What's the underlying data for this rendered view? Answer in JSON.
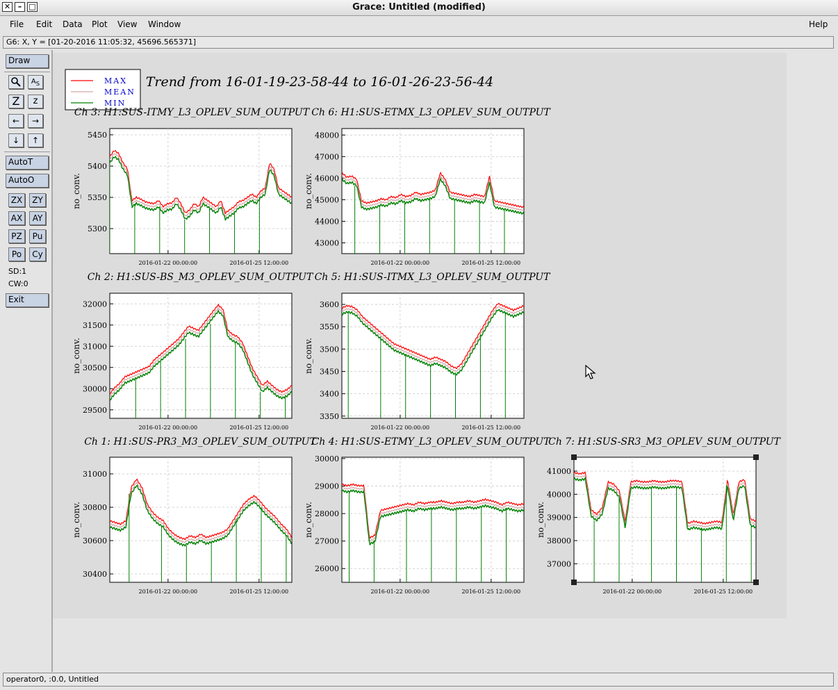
{
  "window": {
    "title": "Grace: Untitled (modified)"
  },
  "menu": {
    "file": "File",
    "edit": "Edit",
    "data": "Data",
    "plot": "Plot",
    "view": "View",
    "window": "Window",
    "help": "Help"
  },
  "locator": "G6: X, Y = [01-20-2016 11:05:32, 45696.565371]",
  "toolbar": {
    "draw": "Draw",
    "autot": "AutoT",
    "autoo": "AutoO",
    "zx": "ZX",
    "zy": "ZY",
    "ax": "AX",
    "ay": "AY",
    "pz": "PZ",
    "pu": "Pu",
    "po": "Po",
    "cy": "Cy",
    "sd": "SD:1",
    "cw": "CW:0",
    "exit": "Exit"
  },
  "status": "operator0, :0.0, Untitled",
  "legend": [
    {
      "label": "MAX",
      "color": "#ff0000"
    },
    {
      "label": "MEAN",
      "color": "#d4a8a8"
    },
    {
      "label": "MIN",
      "color": "#008000"
    }
  ],
  "page_title": "Trend from 16-01-19-23-58-44 to 16-01-26-23-56-44",
  "chart_data": [
    {
      "type": "line",
      "title": "Ch 3: H1:SUS-ITMY_L3_OPLEV_SUM_OUTPUT",
      "ylabel": "no_conv.",
      "ylim": [
        5260,
        5460
      ],
      "yticks": [
        5300,
        5350,
        5400,
        5450
      ],
      "xticks": [
        "2016-01-22 00:00:00",
        "2016-01-25 12:00:00"
      ],
      "grid": true,
      "values": [
        5410,
        5420,
        5415,
        5400,
        5390,
        5340,
        5345,
        5342,
        5338,
        5336,
        5335,
        5340,
        5330,
        5335,
        5336,
        5345,
        5335,
        5320,
        5325,
        5335,
        5330,
        5345,
        5340,
        5335,
        5330,
        5340,
        5320,
        5325,
        5330,
        5338,
        5340,
        5345,
        5350,
        5345,
        5355,
        5360,
        5400,
        5390,
        5360,
        5355,
        5350,
        5345
      ]
    },
    {
      "type": "line",
      "title": "Ch 6: H1:SUS-ETMX_L3_OPLEV_SUM_OUTPUT",
      "ylabel": "no_conv.",
      "ylim": [
        42500,
        48300
      ],
      "yticks": [
        43000,
        44000,
        45000,
        46000,
        47000,
        48000
      ],
      "xticks": [
        "2016-01-22 00:00:00",
        "2016-01-25 12:00:00"
      ],
      "grid": true,
      "values": [
        46100,
        45900,
        45950,
        45800,
        44800,
        44700,
        44750,
        44800,
        44900,
        44850,
        45000,
        44950,
        45100,
        45000,
        45050,
        45200,
        45100,
        45150,
        45200,
        45300,
        46100,
        45800,
        45200,
        45150,
        45100,
        45050,
        45000,
        45100,
        45050,
        45000,
        45950,
        44800,
        44750,
        44700,
        44650,
        44600,
        44550,
        44500
      ]
    },
    {
      "type": "line",
      "title": "Ch 2: H1:SUS-BS_M3_OPLEV_SUM_OUTPUT",
      "ylabel": "no_conv.",
      "ylim": [
        29300,
        32250
      ],
      "yticks": [
        29500,
        30000,
        30500,
        31000,
        31500,
        32000
      ],
      "xticks": [
        "2016-01-22 00:00:00",
        "2016-01-25 12:00:00"
      ],
      "grid": true,
      "values": [
        29800,
        29950,
        30050,
        30200,
        30250,
        30300,
        30350,
        30400,
        30450,
        30600,
        30700,
        30800,
        30900,
        31000,
        31100,
        31250,
        31400,
        31350,
        31300,
        31450,
        31600,
        31750,
        31900,
        31800,
        31300,
        31200,
        31150,
        31000,
        30700,
        30400,
        30200,
        30000,
        30100,
        30000,
        29900,
        29850,
        29900,
        30000
      ]
    },
    {
      "type": "line",
      "title": "Ch 5: H1:SUS-ITMX_L3_OPLEV_SUM_OUTPUT",
      "ylabel": "no_conv.",
      "ylim": [
        3345,
        3625
      ],
      "yticks": [
        3350,
        3400,
        3450,
        3500,
        3550,
        3600
      ],
      "xticks": [
        "2016-01-22 00:00:00",
        "2016-01-25 12:00:00"
      ],
      "grid": true,
      "values": [
        3585,
        3590,
        3588,
        3580,
        3565,
        3555,
        3545,
        3535,
        3525,
        3515,
        3505,
        3500,
        3495,
        3490,
        3485,
        3480,
        3475,
        3470,
        3475,
        3470,
        3465,
        3455,
        3450,
        3460,
        3480,
        3500,
        3520,
        3540,
        3560,
        3580,
        3595,
        3590,
        3585,
        3580,
        3585,
        3590
      ]
    },
    {
      "type": "line",
      "title": "Ch 1: H1:SUS-PR3_M3_OPLEV_SUM_OUTPUT",
      "ylabel": "no_conv.",
      "ylim": [
        30350,
        31100
      ],
      "yticks": [
        30400,
        30600,
        30800,
        31000
      ],
      "xticks": [
        "2016-01-22 00:00:00",
        "2016-01-25 12:00:00"
      ],
      "grid": true,
      "values": [
        30700,
        30690,
        30680,
        30700,
        30900,
        30950,
        30900,
        30800,
        30750,
        30720,
        30700,
        30650,
        30620,
        30600,
        30590,
        30610,
        30600,
        30620,
        30600,
        30610,
        30620,
        30630,
        30650,
        30700,
        30750,
        30800,
        30830,
        30850,
        30820,
        30780,
        30750,
        30720,
        30680,
        30650,
        30600
      ]
    },
    {
      "type": "line",
      "title": "Ch 4: H1:SUS-ETMY_L3_OPLEV_SUM_OUTPUT",
      "ylabel": "no_conv.",
      "ylim": [
        25500,
        30050
      ],
      "yticks": [
        26000,
        27000,
        28000,
        29000,
        30000
      ],
      "xticks": [
        "2016-01-22 00:00:00",
        "2016-01-25 12:00:00"
      ],
      "grid": true,
      "values": [
        28950,
        28900,
        28950,
        28900,
        28900,
        27000,
        27100,
        28000,
        28050,
        28100,
        28150,
        28200,
        28250,
        28200,
        28300,
        28250,
        28300,
        28300,
        28350,
        28300,
        28250,
        28300,
        28300,
        28350,
        28300,
        28350,
        28400,
        28350,
        28300,
        28200,
        28300,
        28250,
        28200,
        28250
      ]
    },
    {
      "type": "line",
      "title": "Ch 7: H1:SUS-SR3_M3_OPLEV_SUM_OUTPUT",
      "ylabel": "no_conv.",
      "ylim": [
        36200,
        41600
      ],
      "yticks": [
        37000,
        38000,
        39000,
        40000,
        41000
      ],
      "xticks": [
        "2016-01-22 00:00:00",
        "2016-01-25 12:00:00"
      ],
      "grid": true,
      "values": [
        40800,
        40750,
        40800,
        39200,
        39000,
        39300,
        40400,
        40300,
        40000,
        38700,
        40400,
        40450,
        40400,
        40400,
        40450,
        40400,
        40400,
        40450,
        40450,
        40400,
        38600,
        38700,
        38650,
        38600,
        38650,
        38700,
        38650,
        40500,
        39000,
        40400,
        40500,
        38800,
        38700
      ]
    }
  ]
}
